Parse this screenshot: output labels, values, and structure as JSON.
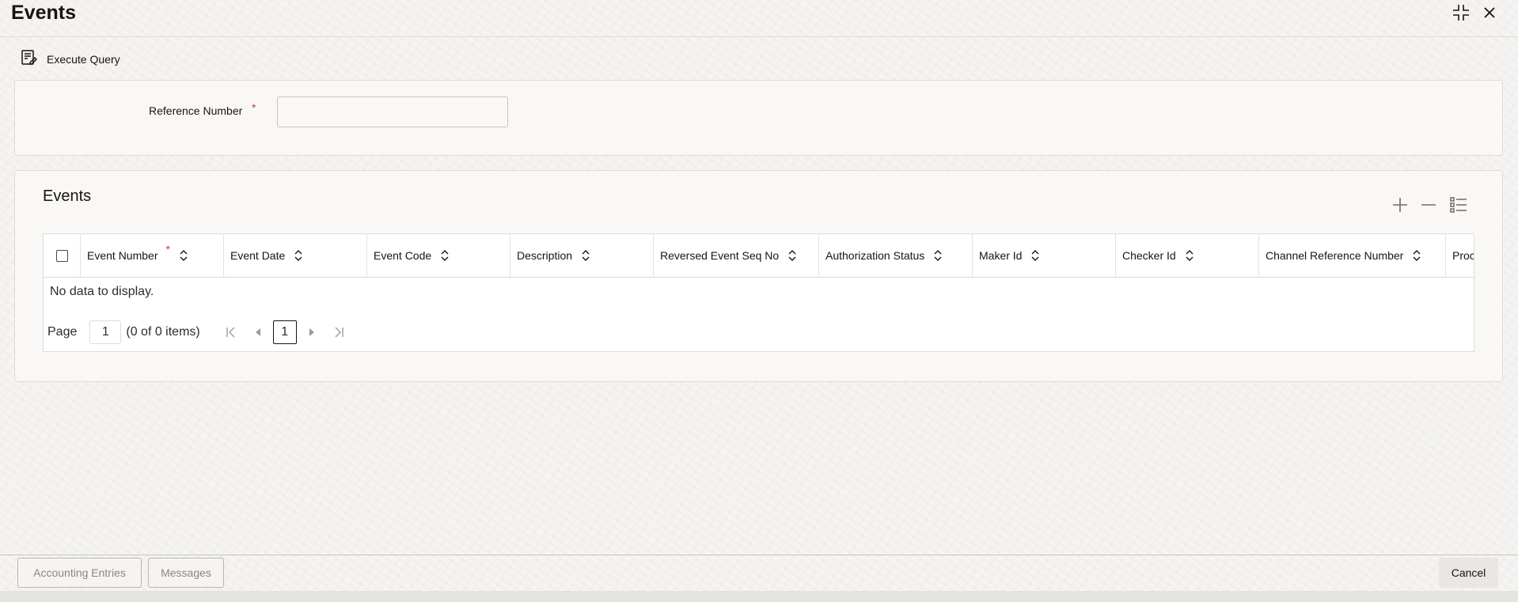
{
  "window": {
    "title": "Events",
    "icons": {
      "maximize": "collapse-icon",
      "close": "close-icon"
    }
  },
  "toolbar": {
    "execute_query_label": "Execute Query",
    "icon": "execute-query-icon"
  },
  "form": {
    "reference_number": {
      "label": "Reference Number",
      "required_mark": "*",
      "value": ""
    }
  },
  "events_section": {
    "title": "Events",
    "actions": [
      "add-icon",
      "remove-icon",
      "column-list-icon"
    ],
    "columns": [
      {
        "label": "Event Number",
        "required_mark": "*"
      },
      {
        "label": "Event Date"
      },
      {
        "label": "Event Code"
      },
      {
        "label": "Description"
      },
      {
        "label": "Reversed Event Seq No"
      },
      {
        "label": "Authorization Status"
      },
      {
        "label": "Maker Id"
      },
      {
        "label": "Checker Id"
      },
      {
        "label": "Channel Reference Number"
      },
      {
        "label": "Proc"
      }
    ],
    "empty_message": "No data to display.",
    "pager": {
      "page_label": "Page",
      "page_value": "1",
      "items_text": "(0 of 0 items)",
      "current_page": "1"
    }
  },
  "footer": {
    "accounting_entries_label": "Accounting Entries",
    "messages_label": "Messages",
    "cancel_label": "Cancel"
  },
  "colors": {
    "required": "#c73f2a",
    "border": "#dedcd8",
    "background": "#f5f4f2"
  }
}
